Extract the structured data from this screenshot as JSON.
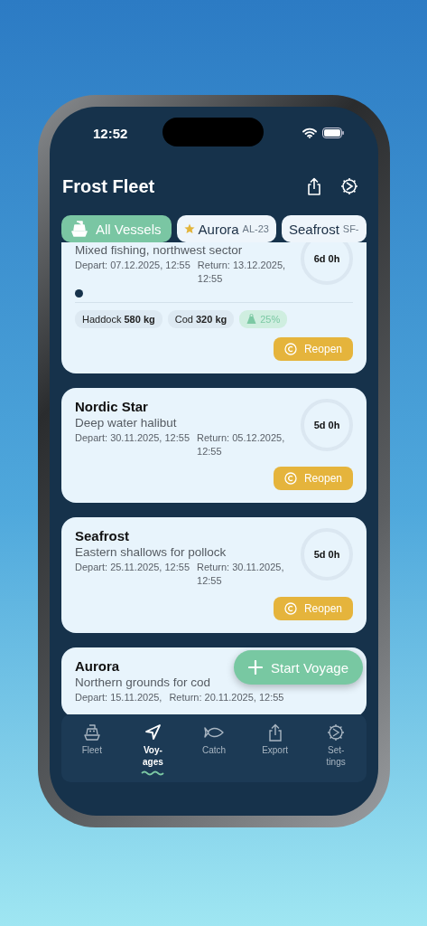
{
  "status_bar": {
    "time": "12:52"
  },
  "header": {
    "title": "Frost Fleet"
  },
  "filters": [
    {
      "label": "All Vessels",
      "starred": false,
      "selected": true
    },
    {
      "label": "Aurora",
      "code": "AL-23",
      "starred": true,
      "selected": false
    },
    {
      "label": "Seafrost",
      "code": "SF-",
      "starred": false,
      "selected": false
    }
  ],
  "voyages": [
    {
      "kind": "active",
      "subtitle": "Mixed fishing, northwest sector",
      "depart": "Depart: 07.12.2025, 12:55",
      "return": "Return: 13.12.2025, 12:55",
      "duration": "6d 0h",
      "catches": [
        {
          "species": "Haddock",
          "weight": "580 kg"
        },
        {
          "species": "Cod",
          "weight": "320 kg"
        }
      ],
      "load": "25%",
      "action": "Reopen"
    },
    {
      "kind": "completed",
      "title": "Nordic Star",
      "subtitle": "Deep water halibut",
      "depart": "Depart: 30.11.2025, 12:55",
      "return": "Return: 05.12.2025, 12:55",
      "duration": "5d 0h",
      "action": "Reopen"
    },
    {
      "kind": "completed",
      "title": "Seafrost",
      "subtitle": "Eastern shallows for pollock",
      "depart": "Depart: 25.11.2025, 12:55",
      "return": "Return: 30.11.2025, 12:55",
      "duration": "5d 0h",
      "action": "Reopen"
    },
    {
      "kind": "completed",
      "title": "Aurora",
      "subtitle": "Northern grounds for cod",
      "depart": "Depart: 15.11.2025,",
      "return": "Return: 20.11.2025, 12:55"
    }
  ],
  "fab": {
    "label": "Start Voyage"
  },
  "tabs": [
    {
      "label": "Fleet",
      "selected": false
    },
    {
      "label": "Voy-ages",
      "selected": true
    },
    {
      "label": "Catch",
      "selected": false
    },
    {
      "label": "Export",
      "selected": false
    },
    {
      "label": "Set-tings",
      "selected": false
    }
  ]
}
